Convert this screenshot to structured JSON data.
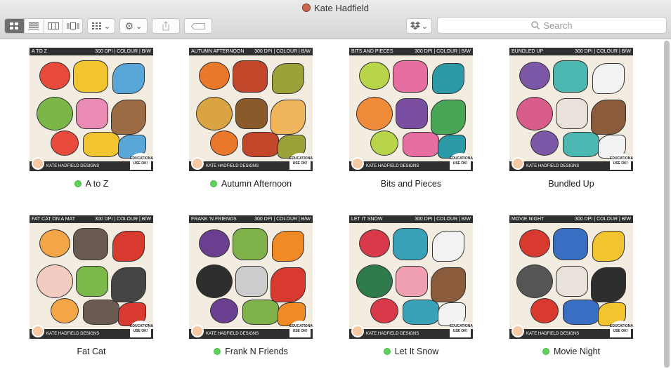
{
  "window": {
    "title": "Kate Hadfield"
  },
  "toolbar": {
    "search_placeholder": "Search",
    "view_icons": [
      "icon-view-icon",
      "list-view-icon",
      "column-view-icon",
      "cover-flow-icon"
    ]
  },
  "items": [
    {
      "name": "A to Z",
      "tag": true,
      "thumb_title": "A TO Z",
      "colors": [
        "#e84a3c",
        "#f2c530",
        "#59a7d8",
        "#7ab648",
        "#e98bb3",
        "#9c6b44"
      ]
    },
    {
      "name": "Autumn Afternoon",
      "tag": true,
      "thumb_title": "AUTUMN AFTERNOON",
      "colors": [
        "#e9782a",
        "#c2462a",
        "#9aa23a",
        "#d9a441",
        "#8b5a2b",
        "#f0b55b"
      ]
    },
    {
      "name": "Bits and Pieces",
      "tag": false,
      "thumb_title": "BITS AND PIECES",
      "colors": [
        "#b8d44a",
        "#e76ea1",
        "#2c9aa6",
        "#f08b3a",
        "#7a4ea0",
        "#4aa657"
      ]
    },
    {
      "name": "Bundled Up",
      "tag": false,
      "thumb_title": "BUNDLED UP",
      "colors": [
        "#7c57a6",
        "#4cb8b1",
        "#f2f2f2",
        "#d95d8a",
        "#e8e2da",
        "#8a5c3c"
      ]
    },
    {
      "name": "Fat Cat",
      "tag": false,
      "thumb_title": "FAT CAT ON A MAT",
      "colors": [
        "#f3a548",
        "#6b5a52",
        "#d93a2f",
        "#f2ccc0",
        "#7bba4a",
        "#444444"
      ]
    },
    {
      "name": "Frank N Friends",
      "tag": true,
      "thumb_title": "FRANK 'N FRIENDS",
      "colors": [
        "#6a3f8f",
        "#7fb24a",
        "#f08a25",
        "#2e2e2e",
        "#cccccc",
        "#d93a2f"
      ]
    },
    {
      "name": "Let It Snow",
      "tag": true,
      "thumb_title": "LET IT SNOW",
      "colors": [
        "#d93a4a",
        "#3aa2b8",
        "#f2f2f2",
        "#2e7a4a",
        "#f0a0b0",
        "#8a5c3c"
      ]
    },
    {
      "name": "Movie Night",
      "tag": true,
      "thumb_title": "MOVIE NIGHT",
      "colors": [
        "#d93a2f",
        "#3a6ec2",
        "#f2c530",
        "#555555",
        "#e8e2da",
        "#2e2e2e"
      ]
    }
  ],
  "thumb_meta": {
    "dpi": "300 DPI | COLOUR | B/W",
    "brand": "KATE HADFIELD DESIGNS",
    "edu": "EDUCATIONAL USE OK!"
  },
  "tag_color": "#5fd15a"
}
